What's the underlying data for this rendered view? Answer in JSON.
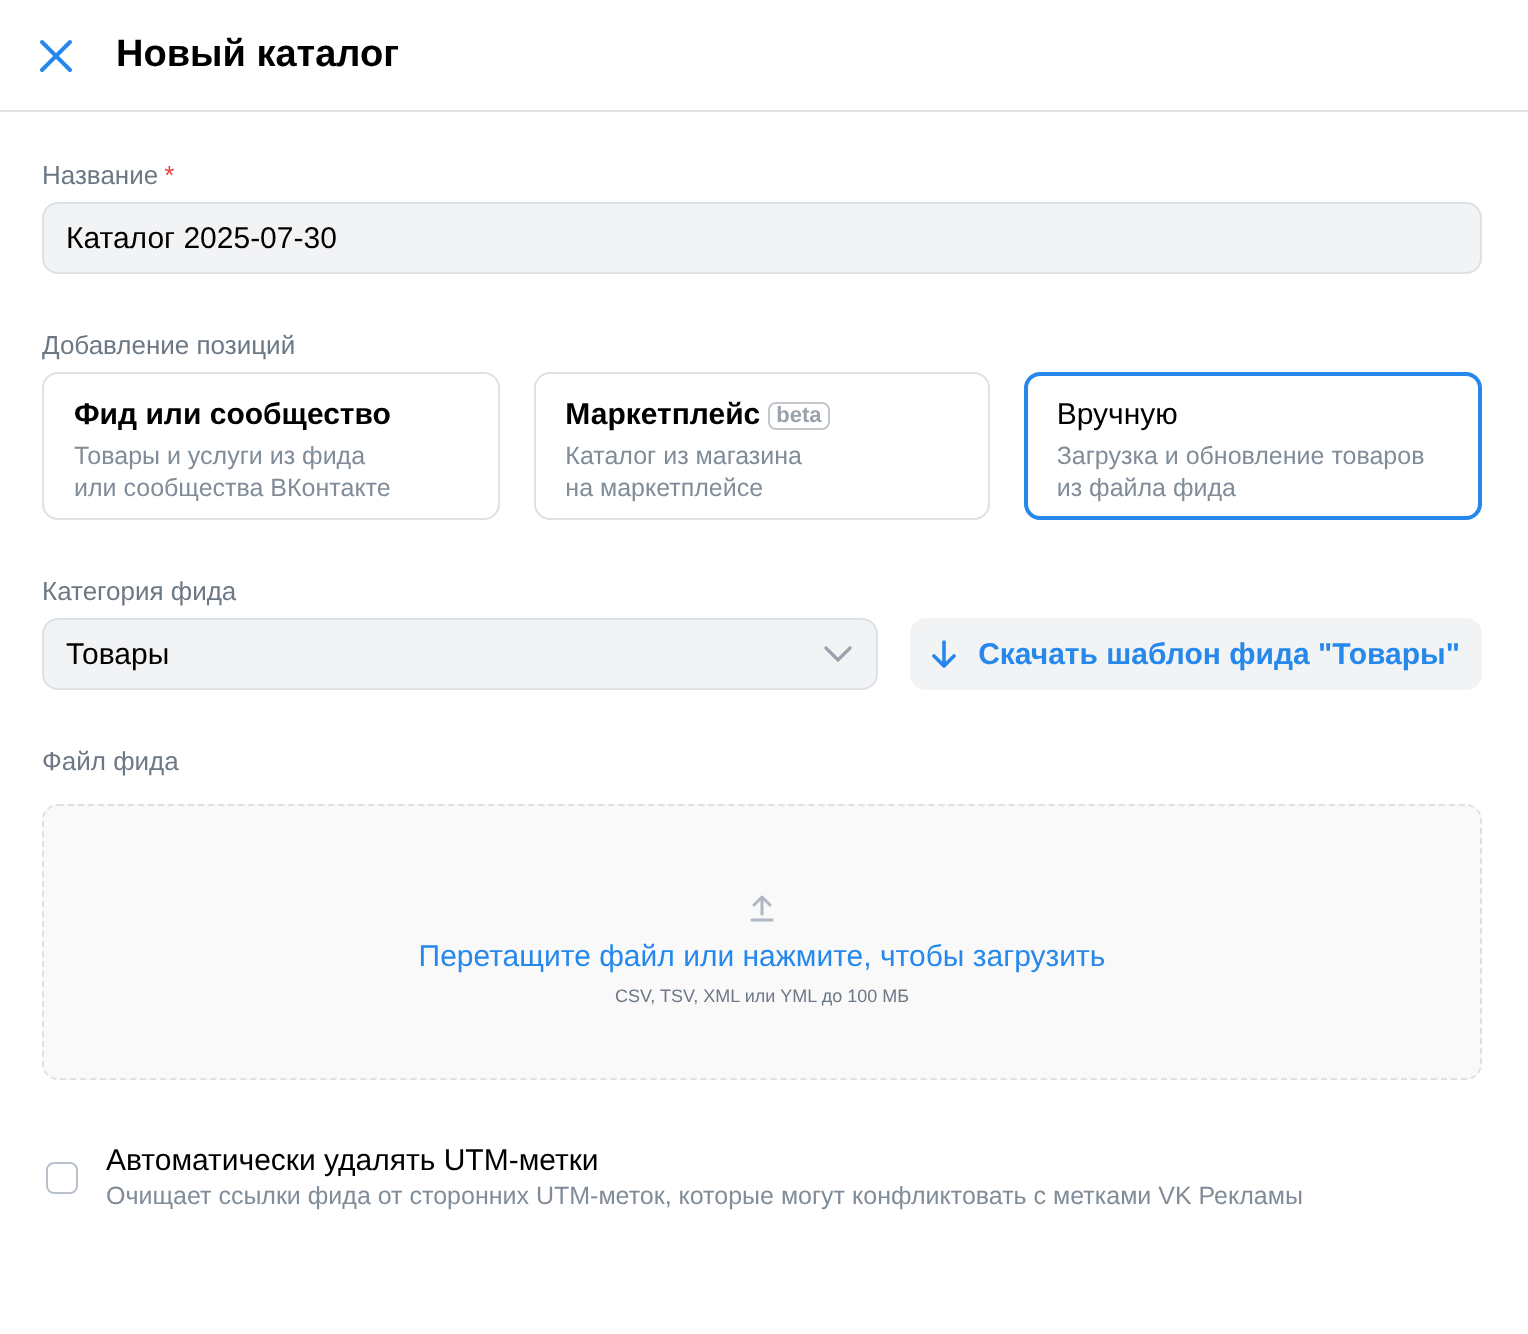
{
  "header": {
    "title": "Новый каталог"
  },
  "name_field": {
    "label": "Название",
    "required_mark": "*",
    "value": "Каталог 2025-07-30"
  },
  "positions": {
    "label": "Добавление позиций",
    "options": [
      {
        "title": "Фид или сообщество",
        "description": "Товары и услуги из фида\nили сообщества ВКонтакте",
        "selected": false
      },
      {
        "title": "Маркетплейс",
        "badge": "beta",
        "description": "Каталог из магазина\nна маркетплейсе",
        "selected": false
      },
      {
        "title": "Вручную",
        "description": "Загрузка и обновление товаров\nиз файла фида",
        "selected": true
      }
    ]
  },
  "category": {
    "label": "Категория фида",
    "value": "Товары",
    "download_button": "Скачать шаблон фида \"Товары\""
  },
  "file": {
    "label": "Файл фида",
    "prompt": "Перетащите файл или нажмите, чтобы загрузить",
    "hint": "CSV, TSV, XML или YML до 100 МБ"
  },
  "utm": {
    "label": "Автоматически удалять UTM-метки",
    "description": "Очищает ссылки фида от сторонних UTM-меток, которые могут конфликтовать с метками VK Рекламы",
    "checked": false
  }
}
